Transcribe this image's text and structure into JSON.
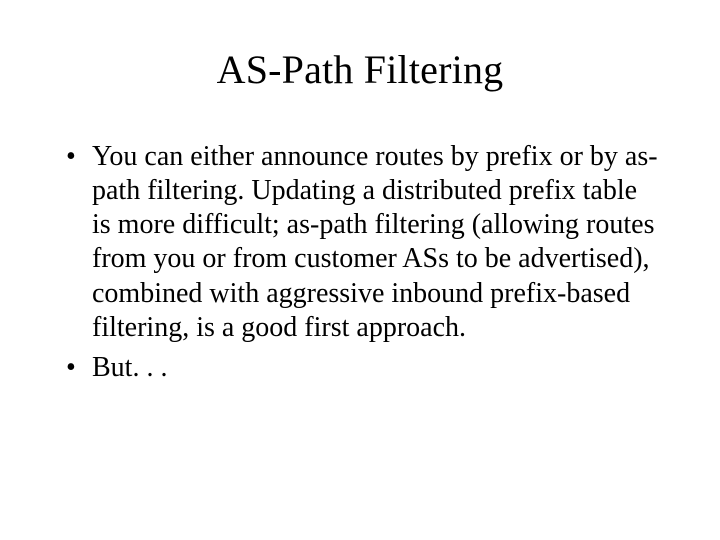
{
  "slide": {
    "title": "AS-Path Filtering",
    "bullets": [
      "You can either announce routes by prefix or by as-path filtering.  Updating a distributed prefix table is more difficult; as-path filtering (allowing routes from you or from customer ASs to be advertised), combined with aggressive inbound prefix-based filtering, is a good first approach.",
      "But. . ."
    ]
  }
}
